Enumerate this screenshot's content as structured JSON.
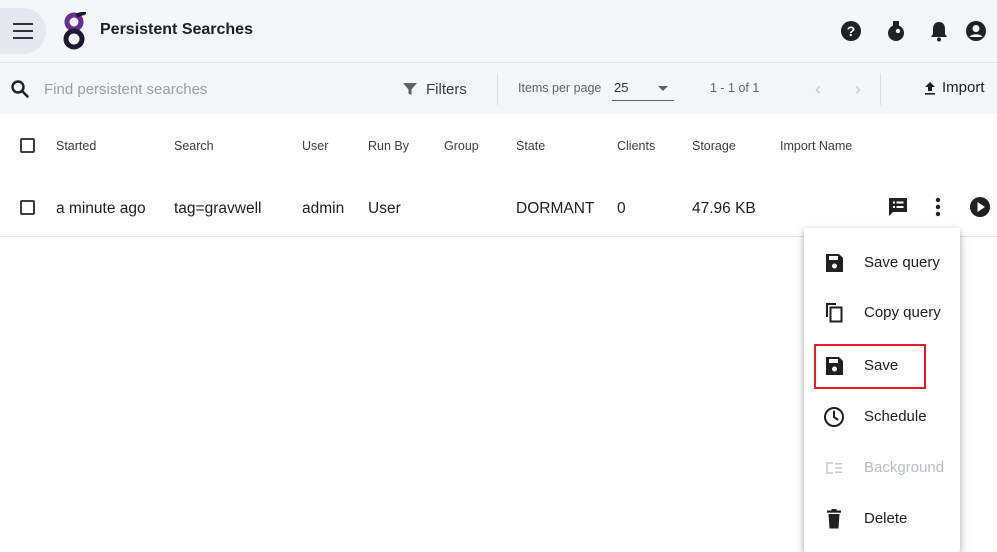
{
  "header": {
    "title": "Persistent Searches",
    "icons": [
      "menu-icon",
      "gravwell-logo",
      "help-icon",
      "kit-icon",
      "bell-icon",
      "account-icon"
    ]
  },
  "toolbar": {
    "search_placeholder": "Find persistent searches",
    "filters_label": "Filters",
    "items_per_page_label": "Items per page",
    "items_per_page_value": "25",
    "range_label": "1 - 1 of 1",
    "import_label": "Import"
  },
  "table": {
    "columns": [
      "Started",
      "Search",
      "User",
      "Run By",
      "Group",
      "State",
      "Clients",
      "Storage",
      "Import Name"
    ],
    "rows": [
      {
        "started": "a minute ago",
        "search": "tag=gravwell",
        "user": "admin",
        "run_by": "User",
        "group": "",
        "state": "DORMANT",
        "clients": "0",
        "storage": "47.96 KB",
        "import_name": ""
      }
    ]
  },
  "context_menu": {
    "items": [
      {
        "label": "Save query",
        "icon": "save-icon",
        "enabled": true
      },
      {
        "label": "Copy query",
        "icon": "copy-icon",
        "enabled": true
      },
      {
        "label": "Save",
        "icon": "save-icon",
        "enabled": true,
        "highlighted": true
      },
      {
        "label": "Schedule",
        "icon": "clock-icon",
        "enabled": true
      },
      {
        "label": "Background",
        "icon": "background-icon",
        "enabled": false
      },
      {
        "label": "Delete",
        "icon": "trash-icon",
        "enabled": true
      }
    ]
  },
  "colors": {
    "header_bg": "#f5f6fa",
    "brand_purple": "#6a2e8f",
    "highlight_border": "#e02020",
    "disabled_text": "#b9bcc0"
  }
}
